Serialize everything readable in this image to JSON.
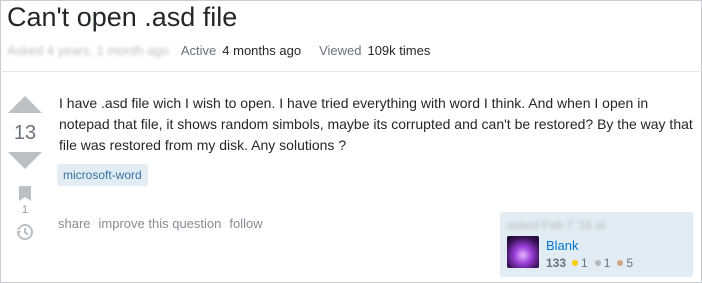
{
  "question": {
    "title": "Can't open .asd file",
    "meta": {
      "asked_blurred": "Asked 4 years, 1 month ago",
      "active_label": "Active",
      "active_value": "4 months ago",
      "viewed_label": "Viewed",
      "viewed_value": "109k times"
    },
    "score": "13",
    "favorites": "1",
    "body": "I have .asd file wich I wish to open. I have tried everything with word I think. And when I open in notepad that file, it shows random simbols, maybe its corrupted and can't be restored? By the way that file was restored from my disk. Any solutions ?",
    "tags": [
      "microsoft-word"
    ],
    "actions": [
      "share",
      "improve this question",
      "follow"
    ]
  },
  "user_card": {
    "asked_blurred": "asked Feb 7 '16 at",
    "name": "Blank",
    "reputation": "133",
    "gold": "1",
    "silver": "1",
    "bronze": "5"
  },
  "colors": {
    "accent_link": "#0077cc",
    "tag_bg": "#e1ecf4",
    "tag_text": "#39739d",
    "vote_arrow": "#bbc0c4"
  },
  "icons": [
    "up-vote-arrow",
    "down-vote-arrow",
    "bookmark-icon",
    "history-icon"
  ]
}
